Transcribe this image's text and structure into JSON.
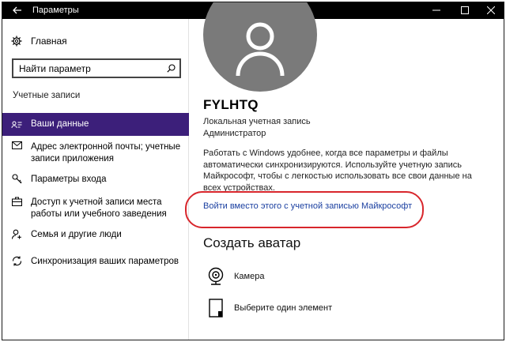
{
  "window": {
    "title": "Параметры",
    "back_icon": "back-arrow-icon",
    "minimize_icon": "minimize-icon",
    "maximize_icon": "maximize-icon",
    "close_icon": "close-icon"
  },
  "sidebar": {
    "home_label": "Главная",
    "search_value": "Найти параметр",
    "section_header": "Учетные записи",
    "items": [
      {
        "label": "Ваши данные",
        "icon": "person-card-icon",
        "active": true
      },
      {
        "label": "Адрес электронной почты; учетные записи приложения",
        "icon": "mail-icon",
        "active": false
      },
      {
        "label": "Параметры входа",
        "icon": "key-icon",
        "active": false
      },
      {
        "label": "Доступ к учетной записи места работы или учебного заведения",
        "icon": "briefcase-icon",
        "active": false
      },
      {
        "label": "Семья и другие люди",
        "icon": "person-add-icon",
        "active": false
      },
      {
        "label": "Синхронизация ваших параметров",
        "icon": "sync-icon",
        "active": false
      }
    ]
  },
  "profile": {
    "username": "FYLHTQ",
    "account_type": "Локальная учетная запись",
    "role": "Администратор",
    "info": "Работать с Windows удобнее, когда все параметры и файлы автоматически синхронизируются. Используйте учетную запись Майкрософт, чтобы с легкостью использовать все свои данные на всех устройствах.",
    "ms_link": "Войти вместо этого с учетной записью Майкрософт",
    "avatar_heading": "Создать аватар",
    "options": [
      {
        "label": "Камера",
        "icon": "camera-icon"
      },
      {
        "label": "Выберите один элемент",
        "icon": "file-icon"
      }
    ]
  },
  "colors": {
    "active_item_bg": "#3c1f7a",
    "link": "#1a3fa0",
    "highlight": "#d8262c",
    "avatar_bg": "#7a7a7a"
  }
}
